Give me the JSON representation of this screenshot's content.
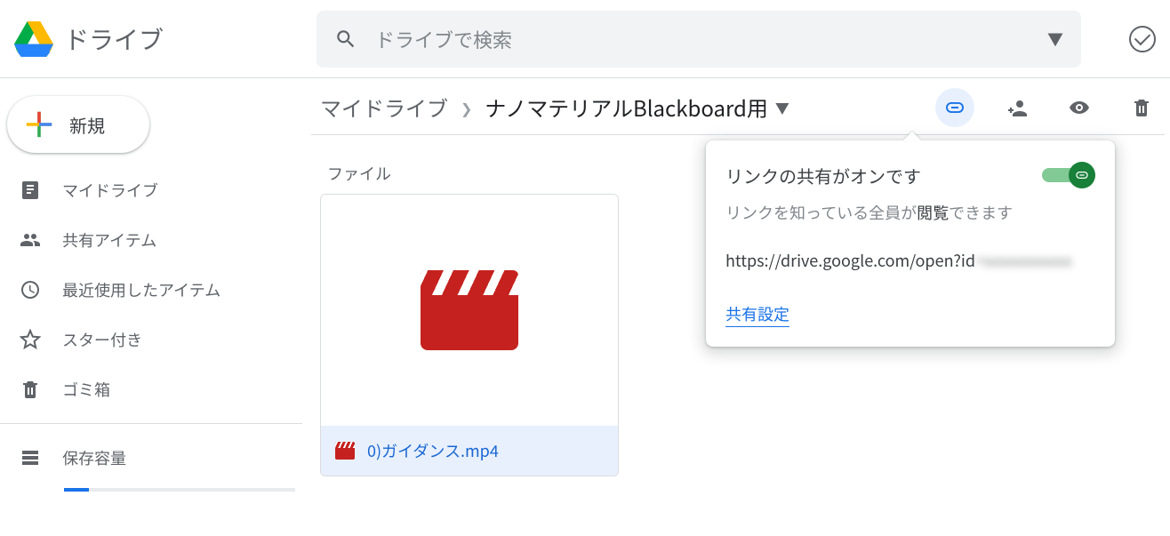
{
  "app": {
    "name": "ドライブ"
  },
  "search": {
    "placeholder": "ドライブで検索"
  },
  "new_button": "新規",
  "sidebar": {
    "items": [
      {
        "label": "マイドライブ"
      },
      {
        "label": "共有アイテム"
      },
      {
        "label": "最近使用したアイテム"
      },
      {
        "label": "スター付き"
      },
      {
        "label": "ゴミ箱"
      }
    ],
    "storage_label": "保存容量"
  },
  "breadcrumb": {
    "top": "マイドライブ",
    "current": "ナノマテリアルBlackboard用"
  },
  "section_label": "ファイル",
  "file": {
    "name": "0)ガイダンス.mp4"
  },
  "popover": {
    "title": "リンクの共有がオンです",
    "sub_prefix": "リンクを知っている全員が",
    "sub_bold_part": "閲覧",
    "sub_suffix": "できます",
    "url_visible": "https://drive.google.com/open?id",
    "settings": "共有設定"
  }
}
